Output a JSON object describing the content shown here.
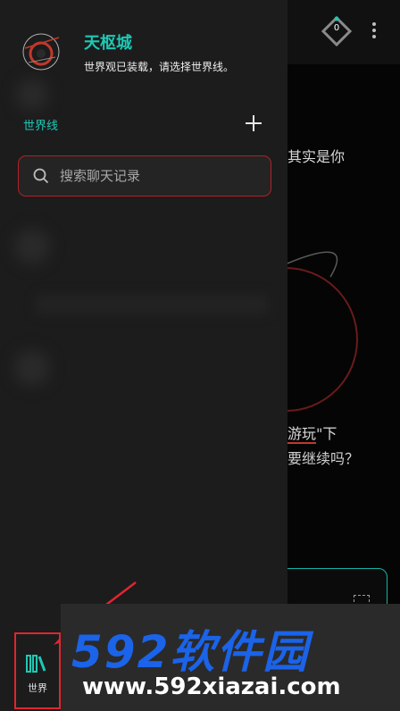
{
  "header": {
    "badge_count": "0"
  },
  "story": {
    "line1": "其实是你",
    "line2_prefix": "",
    "line2_underlined": "游玩",
    "line2_suffix": "\"下",
    "line3": "要继续吗？"
  },
  "drawer": {
    "world_title": "天枢城",
    "world_subtitle": "世界观已装载，请选择世界线。",
    "section_label": "世界线",
    "search_placeholder": "搜索聊天记录"
  },
  "bottom_nav": {
    "world_label": "世界"
  },
  "watermark": {
    "logo_text": "592软件园",
    "url": "www.592xiazai.com"
  },
  "colors": {
    "accent": "#1ec8b5",
    "highlight_red": "#e0262f",
    "watermark_blue": "#1b63e8"
  }
}
